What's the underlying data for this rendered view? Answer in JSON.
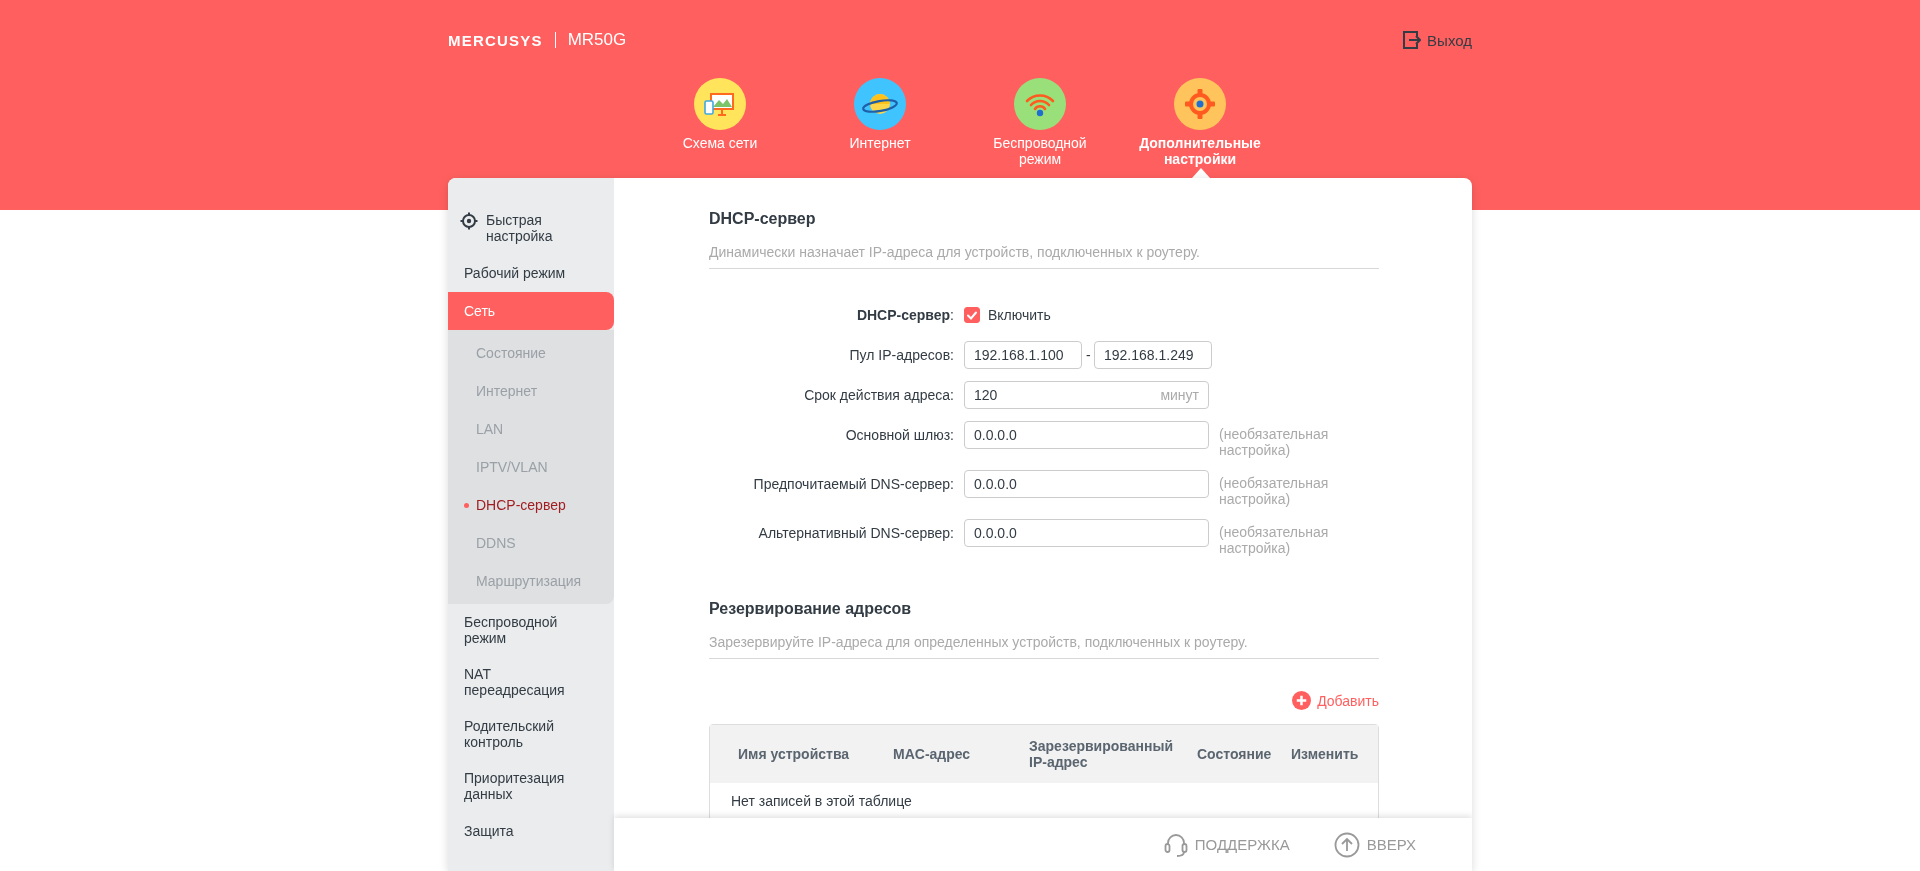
{
  "header": {
    "brand": "MERCUSYS",
    "model": "MR50G",
    "logout": "Выход"
  },
  "nav": [
    {
      "kind": "map",
      "label": "Схема сети",
      "selected": false
    },
    {
      "kind": "internet",
      "label": "Интернет",
      "selected": false
    },
    {
      "kind": "wireless",
      "label": "Беспроводной режим",
      "selected": false
    },
    {
      "kind": "advanced",
      "label": "Дополнительные настройки",
      "selected": true
    }
  ],
  "sidebar": {
    "items": [
      {
        "kind": "gear",
        "label": "Быстрая настройка",
        "selected": false
      },
      {
        "kind": "plain",
        "label": "Рабочий режим",
        "selected": false
      },
      {
        "kind": "plain",
        "label": "Сеть",
        "selected": true,
        "expanded": true,
        "children": [
          {
            "label": "Состояние",
            "selected": false
          },
          {
            "label": "Интернет",
            "selected": false
          },
          {
            "label": "LAN",
            "selected": false
          },
          {
            "label": "IPTV/VLAN",
            "selected": false
          },
          {
            "label": "DHCP-сервер",
            "selected": true
          },
          {
            "label": "DDNS",
            "selected": false
          },
          {
            "label": "Маршрутизация",
            "selected": false
          }
        ]
      },
      {
        "kind": "plain",
        "label": "Беспроводной режим",
        "selected": false
      },
      {
        "kind": "plain",
        "label": "NAT переадресация",
        "selected": false
      },
      {
        "kind": "plain",
        "label": "Родительский контроль",
        "selected": false
      },
      {
        "kind": "plain",
        "label": "Приоритезация данных",
        "selected": false
      },
      {
        "kind": "plain",
        "label": "Защита",
        "selected": false
      }
    ]
  },
  "dhcp": {
    "title": "DHCP-сервер",
    "description": "Динамически назначает IP-адреса для устройств, подключенных к роутеру.",
    "fields": [
      {
        "kind": "checkbox",
        "label": "DHCP-сервер",
        "colon": ":",
        "checked": true,
        "text": "Включить"
      },
      {
        "kind": "range",
        "label": "Пул IP-адресов:",
        "values": [
          "192.168.1.100",
          "192.168.1.249"
        ],
        "separator": "-"
      },
      {
        "kind": "input",
        "label": "Срок действия адреса:",
        "value": "120",
        "unit": "минут"
      },
      {
        "kind": "input",
        "label": "Основной шлюз:",
        "value": "0.0.0.0",
        "note": "(необязательная настройка)"
      },
      {
        "kind": "input",
        "label": "Предпочитаемый DNS-сервер:",
        "value": "0.0.0.0",
        "note": "(необязательная настройка)"
      },
      {
        "kind": "input",
        "label": "Альтернативный DNS-сервер:",
        "value": "0.0.0.0",
        "note": "(необязательная настройка)"
      }
    ]
  },
  "reservation": {
    "title": "Резервирование адресов",
    "description": "Зарезервируйте IP-адреса для определенных устройств, подключенных к роутеру.",
    "add": "Добавить",
    "columns": [
      "Имя устройства",
      "MAC-адрес",
      "Зарезервированный IP-адрес",
      "Состояние",
      "Изменить"
    ],
    "empty": "Нет записей в этой таблице"
  },
  "footer": {
    "support": "ПОДДЕРЖКА",
    "top": "ВВЕРХ"
  }
}
